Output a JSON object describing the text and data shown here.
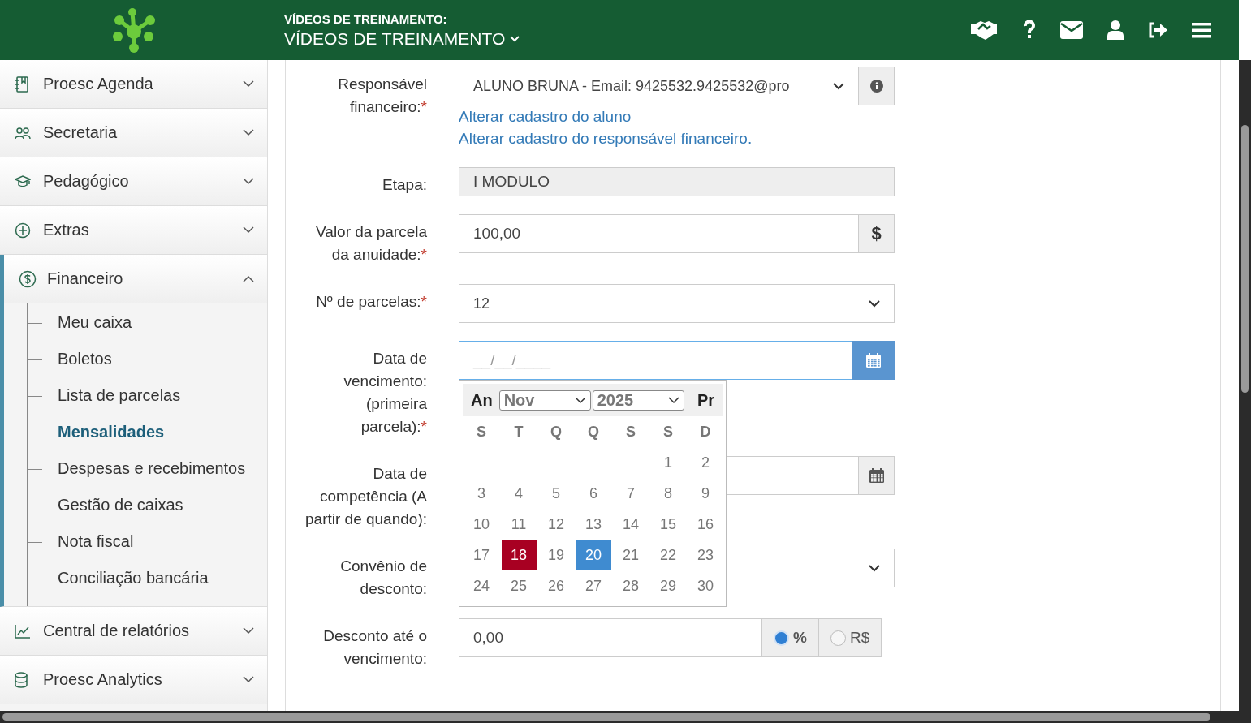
{
  "header": {
    "subtitle": "VÍDEOS DE TREINAMENTO:",
    "title": "VÍDEOS DE TREINAMENTO"
  },
  "toolbar": [
    {
      "kind": "handshake"
    },
    {
      "kind": "help"
    },
    {
      "kind": "mail"
    },
    {
      "kind": "user"
    },
    {
      "kind": "logout"
    },
    {
      "kind": "menu"
    }
  ],
  "sidebar": {
    "items": [
      {
        "label": "Proesc Agenda",
        "expanded": false
      },
      {
        "label": "Secretaria",
        "expanded": false
      },
      {
        "label": "Pedagógico",
        "expanded": false
      },
      {
        "label": "Extras",
        "expanded": false
      },
      {
        "label": "Financeiro",
        "expanded": true,
        "children": [
          {
            "label": "Meu caixa",
            "selected": false
          },
          {
            "label": "Boletos",
            "selected": false
          },
          {
            "label": "Lista de parcelas",
            "selected": false
          },
          {
            "label": "Mensalidades",
            "selected": true
          },
          {
            "label": "Despesas e recebimentos",
            "selected": false
          },
          {
            "label": "Gestão de caixas",
            "selected": false
          },
          {
            "label": "Nota fiscal",
            "selected": false
          },
          {
            "label": "Conciliação bancária",
            "selected": false
          }
        ]
      },
      {
        "label": "Central de relatórios",
        "expanded": false
      },
      {
        "label": "Proesc Analytics",
        "expanded": false
      }
    ]
  },
  "fields": [
    {
      "kind": "select",
      "label": "Responsável financeiro:",
      "required_mark": "*",
      "value": "ALUNO BRUNA - Email: 9425532.9425532@pro",
      "info_button": true,
      "links": [
        "Alterar cadastro do aluno",
        "Alterar cadastro do responsável financeiro."
      ]
    },
    {
      "kind": "readonly",
      "label": "Etapa:",
      "value": "I MODULO"
    },
    {
      "kind": "money",
      "label": "Valor da parcela da anuidade:",
      "required_mark": "*",
      "value": "100,00",
      "addon": "$"
    },
    {
      "kind": "select",
      "label": "Nº de parcelas:",
      "required_mark": "*",
      "value": "12"
    },
    {
      "kind": "date",
      "label": "Data de vencimento: (primeira parcela):",
      "required_mark": "*",
      "placeholder": "__/__/____",
      "focused": true
    },
    {
      "kind": "date",
      "label": "Data de competência (A partir de quando):",
      "focused": false
    },
    {
      "kind": "select",
      "label": "Convênio de desconto:"
    },
    {
      "kind": "discount",
      "label": "Desconto até o vencimento:",
      "value": "0,00",
      "options": [
        {
          "label": "%",
          "selected": true
        },
        {
          "label": "R$",
          "selected": false
        }
      ]
    }
  ],
  "datepicker": {
    "prev": "An",
    "month": "Nov",
    "year": "2025",
    "next": "Pr",
    "weekdays": [
      "S",
      "T",
      "Q",
      "Q",
      "S",
      "S",
      "D"
    ],
    "weeks": [
      {
        "days": [
          {
            "day": "1",
            "today": false,
            "selected": false
          },
          {
            "day": "2",
            "today": false,
            "selected": false
          }
        ]
      },
      {
        "days": [
          {
            "day": "3",
            "today": false,
            "selected": false
          },
          {
            "day": "4",
            "today": false,
            "selected": false
          },
          {
            "day": "5",
            "today": false,
            "selected": false
          },
          {
            "day": "6",
            "today": false,
            "selected": false
          },
          {
            "day": "7",
            "today": false,
            "selected": false
          },
          {
            "day": "8",
            "today": false,
            "selected": false
          },
          {
            "day": "9",
            "today": false,
            "selected": false
          }
        ]
      },
      {
        "days": [
          {
            "day": "10",
            "today": false,
            "selected": false
          },
          {
            "day": "11",
            "today": false,
            "selected": false
          },
          {
            "day": "12",
            "today": false,
            "selected": false
          },
          {
            "day": "13",
            "today": false,
            "selected": false
          },
          {
            "day": "14",
            "today": false,
            "selected": false
          },
          {
            "day": "15",
            "today": false,
            "selected": false
          },
          {
            "day": "16",
            "today": false,
            "selected": false
          }
        ]
      },
      {
        "days": [
          {
            "day": "17",
            "today": false,
            "selected": false
          },
          {
            "day": "18",
            "today": true,
            "selected": false
          },
          {
            "day": "19",
            "today": false,
            "selected": false
          },
          {
            "day": "20",
            "today": false,
            "selected": true
          },
          {
            "day": "21",
            "today": false,
            "selected": false
          },
          {
            "day": "22",
            "today": false,
            "selected": false
          },
          {
            "day": "23",
            "today": false,
            "selected": false
          }
        ]
      },
      {
        "days": [
          {
            "day": "24",
            "today": false,
            "selected": false
          },
          {
            "day": "25",
            "today": false,
            "selected": false
          },
          {
            "day": "26",
            "today": false,
            "selected": false
          },
          {
            "day": "27",
            "today": false,
            "selected": false
          },
          {
            "day": "28",
            "today": false,
            "selected": false
          },
          {
            "day": "29",
            "today": false,
            "selected": false
          },
          {
            "day": "30",
            "today": false,
            "selected": false
          }
        ]
      }
    ]
  }
}
